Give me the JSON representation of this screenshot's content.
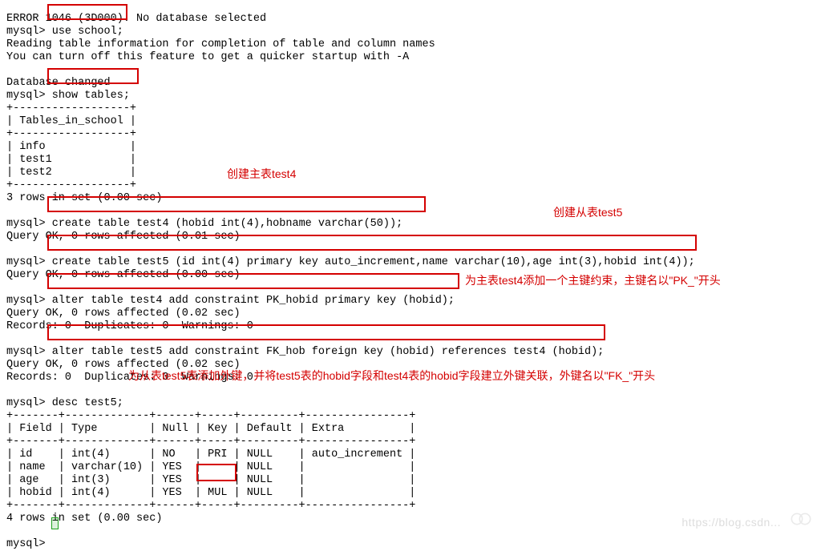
{
  "term": {
    "l0": "ERROR 1046 (3D000): No database selected",
    "l1a": "mysql> ",
    "l1b": "use school;",
    "l2": "Reading table information for completion of table and column names",
    "l3": "You can turn off this feature to get a quicker startup with -A",
    "l4": "",
    "l5": "Database changed",
    "l6a": "mysql> ",
    "l6b": "show tables;",
    "l7": "+------------------+",
    "l8": "| Tables_in_school |",
    "l9": "+------------------+",
    "l10": "| info             |",
    "l11": "| test1            |",
    "l12": "| test2            |",
    "l13": "+------------------+",
    "l14": "3 rows in set (0.00 sec)",
    "l15": "",
    "l16a": "mysql> ",
    "l16b": "create table test4 (hobid int(4),hobname varchar(50));",
    "l17": "Query OK, 0 rows affected (0.01 sec)",
    "l18": "",
    "l19a": "mysql> ",
    "l19b": "create table test5 (id int(4) primary key auto_increment,name varchar(10),age int(3),hobid int(4));",
    "l20": "Query OK, 0 rows affected (0.00 sec)",
    "l21": "",
    "l22a": "mysql> ",
    "l22b": "alter table test4 add constraint PK_hobid primary key (hobid);",
    "l23": "Query OK, 0 rows affected (0.02 sec)",
    "l24": "Records: 0  Duplicates: 0  Warnings: 0",
    "l25": "",
    "l26a": "mysql> ",
    "l26b": "alter table test5 add constraint FK_hob foreign key (hobid) references test4 (hobid);",
    "l27": "Query OK, 0 rows affected (0.02 sec)",
    "l28": "Records: 0  Duplicates: 0  Warnings: 0",
    "l29": "",
    "l30": "mysql> desc test5;",
    "l31": "+-------+-------------+------+-----+---------+----------------+",
    "l32": "| Field | Type        | Null | Key | Default | Extra          |",
    "l33": "+-------+-------------+------+-----+---------+----------------+",
    "l34": "| id    | int(4)      | NO   | PRI | NULL    | auto_increment |",
    "l35": "| name  | varchar(10) | YES  |     | NULL    |                |",
    "l36": "| age   | int(3)      | YES  |     | NULL    |                |",
    "l37": "| hobid | int(4)      | YES  | MUL | NULL    |                |",
    "l38": "+-------+-------------+------+-----+---------+----------------+",
    "l39": "4 rows in set (0.00 sec)",
    "l40": "",
    "l41": "mysql> "
  },
  "annot": {
    "a1": "创建主表test4",
    "a2": "创建从表test5",
    "a3": "为主表test4添加一个主键约束，主键名以\"PK_\"开头",
    "a4": "为从表test5表添加外键，并将test5表的hobid字段和test4表的hobid字段建立外键关联，外键名以\"FK_\"开头"
  },
  "watermark": "https://blog.csdn..."
}
